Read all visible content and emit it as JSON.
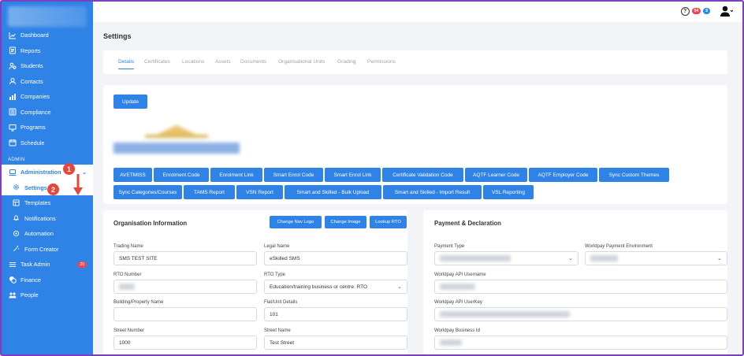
{
  "sidebar": {
    "nav_top": [
      {
        "label": "Dashboard",
        "icon": "chart-line-icon"
      },
      {
        "label": "Reports",
        "icon": "document-icon"
      },
      {
        "label": "Students",
        "icon": "users-icon"
      },
      {
        "label": "Contacts",
        "icon": "contact-icon"
      },
      {
        "label": "Companies",
        "icon": "building-icon"
      },
      {
        "label": "Compliance",
        "icon": "checklist-icon"
      },
      {
        "label": "Programs",
        "icon": "monitor-icon"
      },
      {
        "label": "Schedule",
        "icon": "calendar-icon"
      }
    ],
    "section_admin": "ADMIN",
    "administration": "Administration",
    "settings": "Settings",
    "sub_items": [
      {
        "label": "Templates",
        "icon": "template-icon"
      },
      {
        "label": "Notifications",
        "icon": "bell-icon"
      },
      {
        "label": "Automation",
        "icon": "automation-icon"
      },
      {
        "label": "Form Creator",
        "icon": "magic-wand-icon"
      }
    ],
    "task_admin": "Task Admin",
    "task_admin_badge": "20",
    "finance": "Finance",
    "people": "People"
  },
  "callouts": {
    "one": "1",
    "two": "2"
  },
  "topbar": {
    "help": "?",
    "badge_red": "54",
    "badge_blue": "9"
  },
  "page_title": "Settings",
  "tabs": [
    "Details",
    "Certificates",
    "Locations",
    "Assets",
    "Documents",
    "Organisational Units",
    "Grading",
    "Permissions"
  ],
  "update_button": "Update",
  "action_buttons_row1": [
    "AVETMISS",
    "Enrolment Code",
    "Enrolment Link",
    "Smart Enrol Code",
    "Smart Enrol Link",
    "Certificate Validation Code",
    "AQTF Learner Code",
    "AQTF Employer Code",
    "Sync Custom Themes"
  ],
  "action_buttons_row2": [
    "Sync Categories/Courses",
    "TAMS Report",
    "VSN Report",
    "Smart and Skilled - Bulk Upload",
    "Smart and Skilled - Import Result",
    "VSL Reporting"
  ],
  "org": {
    "title": "Organisation Information",
    "btn_nav_logo": "Change Nav Logo",
    "btn_image": "Change Image",
    "btn_lookup": "Lookup RTO",
    "trading_name_label": "Trading Name",
    "trading_name": "SMS TEST SITE",
    "legal_name_label": "Legal Name",
    "legal_name": "eSkilled SMS",
    "rto_number_label": "RTO Number",
    "rto_type_label": "RTO Type",
    "rto_type": "Education/training business or centre: RTO",
    "building_label": "Building/Property Name",
    "flat_label": "Flat/Unit Details",
    "flat": "101",
    "street_number_label": "Street Number",
    "street_number": "1000",
    "street_name_label": "Street Name",
    "street_name": "Test Street"
  },
  "payment": {
    "title": "Payment & Declaration",
    "payment_type_label": "Payment Type",
    "worldpay_env_label": "Worldpay Payment Environment",
    "api_username_label": "Worldpay API Username",
    "api_userkey_label": "Worldpay API UserKey",
    "business_id_label": "Worldpay Business Id"
  },
  "colors": {
    "primary": "#2f83e6",
    "callout": "#e8463a",
    "badge_red": "#e9465a",
    "badge_blue": "#1e8cf0",
    "frame": "#7b3fbf"
  }
}
